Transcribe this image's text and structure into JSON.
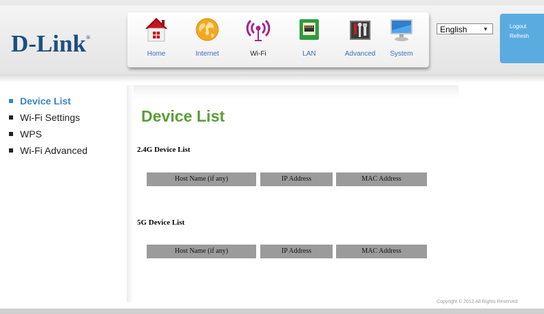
{
  "brand": {
    "logo_text": "D-Link",
    "trademark": "®"
  },
  "nav": {
    "items": [
      {
        "label": "Home",
        "icon": "home-icon"
      },
      {
        "label": "Internet",
        "icon": "globe-icon"
      },
      {
        "label": "Wi-Fi",
        "icon": "wifi-icon"
      },
      {
        "label": "LAN",
        "icon": "lan-icon"
      },
      {
        "label": "Advanced",
        "icon": "toolbox-icon"
      },
      {
        "label": "System",
        "icon": "monitor-icon"
      }
    ],
    "active": "Wi-Fi"
  },
  "language": {
    "selected": "English"
  },
  "account": {
    "logout_label": "Logout",
    "refresh_label": "Refresh"
  },
  "sidebar": {
    "items": [
      {
        "label": "Device List",
        "active": true
      },
      {
        "label": "Wi-Fi Settings",
        "active": false
      },
      {
        "label": "WPS",
        "active": false
      },
      {
        "label": "Wi-Fi Advanced",
        "active": false
      }
    ]
  },
  "main": {
    "title": "Device List",
    "section_24g": {
      "title": "2.4G Device List",
      "columns": [
        "Host Name (if any)",
        "IP Address",
        "MAC Address"
      ]
    },
    "section_5g": {
      "title": "5G Device List",
      "columns": [
        "Host Name (if any)",
        "IP Address",
        "MAC Address"
      ]
    }
  },
  "footer": {
    "copyright": "Copyright © 2012  All Rights Reserved"
  },
  "colors": {
    "brand_blue": "#1d4f80",
    "accent_blue": "#5aace0",
    "title_green": "#5c9e3a",
    "active_link": "#3b84c7",
    "table_header": "#9b9b9b"
  }
}
